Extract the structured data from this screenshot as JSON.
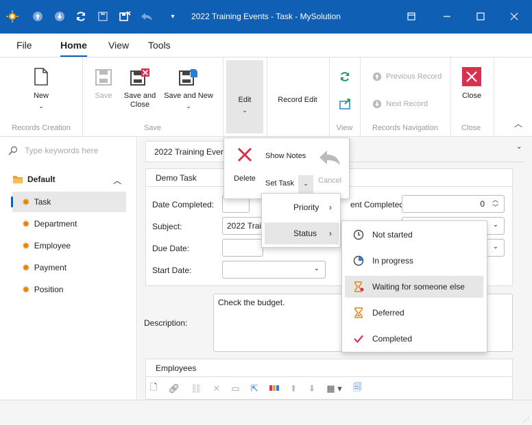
{
  "window": {
    "title": "2022 Training Events - Task - MySolution",
    "qat_icons": [
      "app-logo-icon",
      "up-circle-icon",
      "down-circle-icon",
      "refresh-icon",
      "save-icon",
      "save-close-icon",
      "undo-icon",
      "customize-icon"
    ],
    "controls": [
      "restore-icon",
      "minimize-icon",
      "maximize-icon",
      "close-icon"
    ]
  },
  "ribbon_tabs": [
    "File",
    "Home",
    "View",
    "Tools"
  ],
  "ribbon": {
    "new_label": "New",
    "records_creation_label": "Records Creation",
    "save_label": "Save",
    "save_close_label": "Save and Close",
    "save_new_label": "Save and New",
    "save_group_label": "Save",
    "edit_label": "Edit",
    "record_edit_label": "Record Edit",
    "view_group_label": "View",
    "previous_record_label": "Previous Record",
    "next_record_label": "Next Record",
    "records_navigation_label": "Records Navigation",
    "close_label": "Close",
    "close_group_label": "Close"
  },
  "edit_dropdown": {
    "delete_label": "Delete",
    "show_notes_label": "Show Notes",
    "set_task_label": "Set Task",
    "cancel_label": "Cancel"
  },
  "set_task_menu": {
    "priority_label": "Priority",
    "status_label": "Status"
  },
  "status_menu": {
    "items": [
      {
        "label": "Not started",
        "icon": "clock-icon"
      },
      {
        "label": "In progress",
        "icon": "progress-pie-icon"
      },
      {
        "label": "Waiting for someone else",
        "icon": "hourglass-person-icon"
      },
      {
        "label": "Deferred",
        "icon": "hourglass-icon"
      },
      {
        "label": "Completed",
        "icon": "checkmark-icon"
      }
    ],
    "highlighted_index": 2,
    "colors": {
      "hourglass": "#e8830c",
      "check": "#d9304f"
    }
  },
  "search": {
    "placeholder": "Type keywords here"
  },
  "nav": {
    "group_label": "Default",
    "items": [
      "Task",
      "Department",
      "Employee",
      "Payment",
      "Position"
    ],
    "selected": "Task"
  },
  "document": {
    "tab_label": "2022 Training Events",
    "panel_title": "Demo Task",
    "date_completed_label": "Date Completed:",
    "subject_label": "Subject:",
    "subject_value": "2022 Traini",
    "due_date_label": "Due Date:",
    "start_date_label": "Start Date:",
    "percent_completed_label": "ent Completed:",
    "percent_completed_value": "0",
    "description_label": "Description:",
    "description_value": "Check the budget.",
    "employees_title": "Employees"
  },
  "colors": {
    "title_bar": "#0f5fb4",
    "accent": "#0f5fb4",
    "delete_red": "#d9304f",
    "refresh_green": "#1a9a5c"
  }
}
